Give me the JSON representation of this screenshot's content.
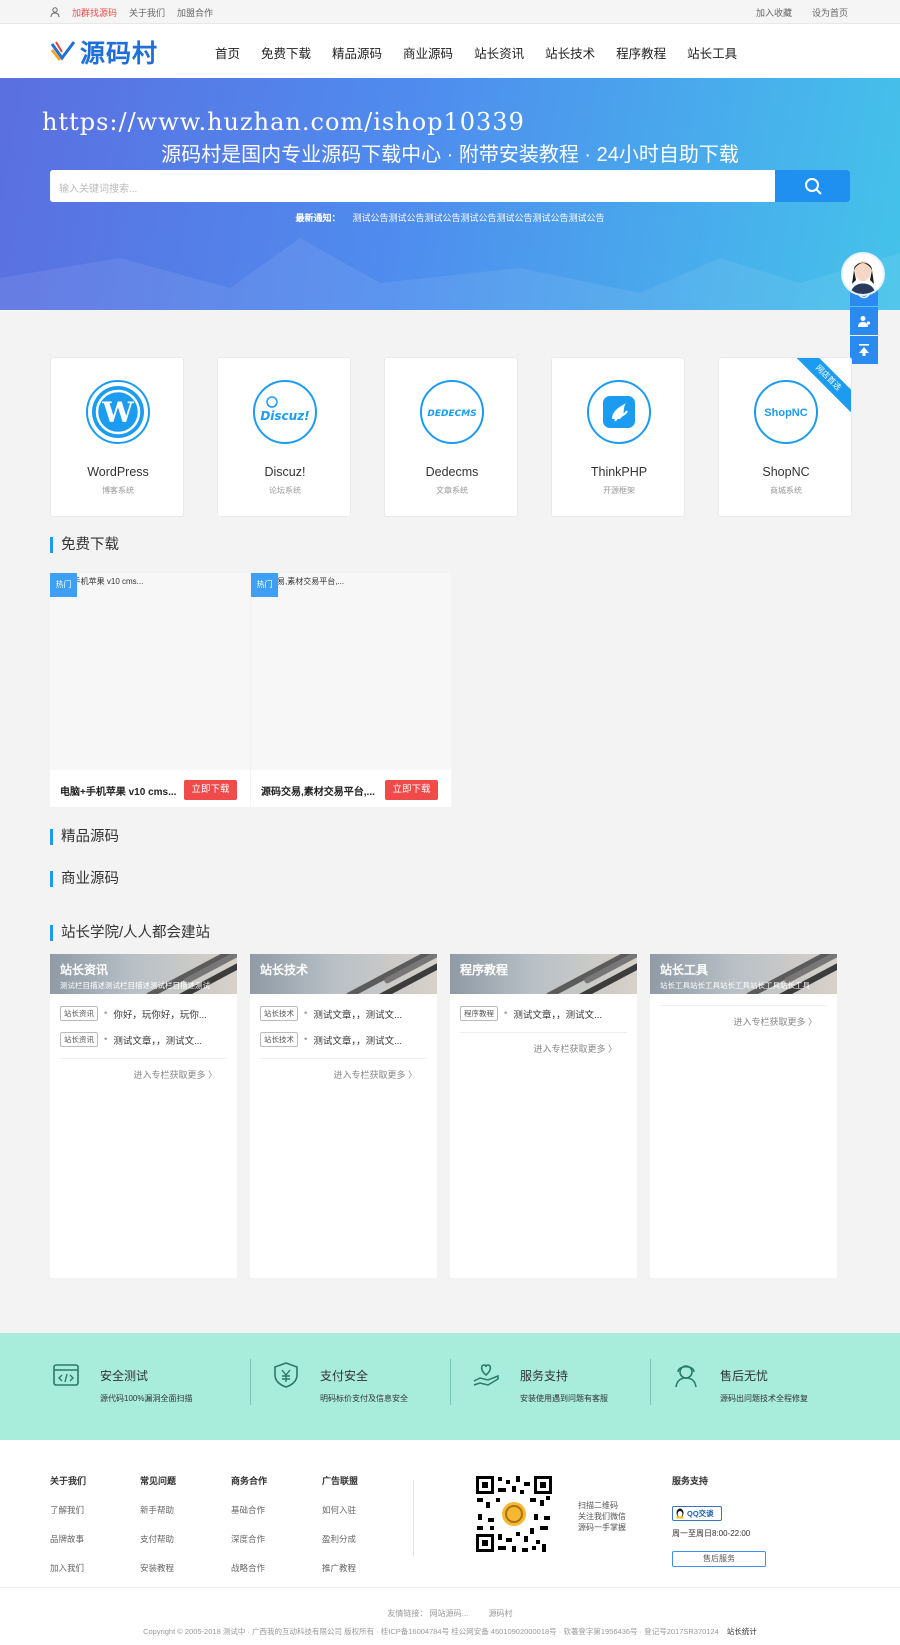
{
  "topbar": {
    "left": [
      "加群找源码",
      "关于我们",
      "加盟合作"
    ],
    "right": [
      "加入收藏",
      "设为首页"
    ]
  },
  "header": {
    "logo_text": "源码村",
    "nav": [
      "首页",
      "免费下载",
      "精品源码",
      "商业源码",
      "站长资讯",
      "站长技术",
      "程序教程",
      "站长工具"
    ]
  },
  "banner": {
    "watermark": "https://www.huzhan.com/ishop10339",
    "slogan": "源码村是国内专业源码下载中心 · 附带安装教程 · 24小时自助下载",
    "search_placeholder": "输入关键词搜索...",
    "notice_label": "最新通知：",
    "notice_text": "测试公告测试公告测试公告测试公告测试公告测试公告测试公告"
  },
  "cms": [
    {
      "name": "WordPress",
      "sub": "博客系统",
      "icon": "wordpress-icon"
    },
    {
      "name": "Discuz!",
      "sub": "论坛系统",
      "icon": "discuz-icon"
    },
    {
      "name": "Dedecms",
      "sub": "文章系统",
      "icon": "dedecms-icon"
    },
    {
      "name": "ThinkPHP",
      "sub": "开源框架",
      "icon": "thinkphp-icon"
    },
    {
      "name": "ShopNC",
      "sub": "商城系统",
      "icon": "shopnc-icon",
      "ribbon": "网店首选"
    }
  ],
  "sections": {
    "free": "免费下载",
    "premium": "精品源码",
    "business": "商业源码",
    "academy": "站长学院/人人都会建站"
  },
  "free_items": [
    {
      "tag": "热门",
      "alt": "电脑+手机苹果 v10 cms...",
      "title": "电脑+手机苹果 v10 cms...",
      "button": "立即下载"
    },
    {
      "tag": "热门",
      "alt": "源码交易,素材交易平台,...",
      "title": "源码交易,素材交易平台,...",
      "button": "立即下载"
    }
  ],
  "columns": [
    {
      "title": "站长资讯",
      "desc": "测试栏目描述测试栏目描述测试栏目描述测试",
      "items": [
        {
          "badge": "站长资讯",
          "text": "你好，玩你好，玩你..."
        },
        {
          "badge": "站长资讯",
          "text": "测试文章，，测试文..."
        }
      ],
      "more": "进入专栏获取更多 〉"
    },
    {
      "title": "站长技术",
      "desc": "",
      "items": [
        {
          "badge": "站长技术",
          "text": "测试文章，，测试文..."
        },
        {
          "badge": "站长技术",
          "text": "测试文章，，测试文..."
        }
      ],
      "more": "进入专栏获取更多 〉"
    },
    {
      "title": "程序教程",
      "desc": "",
      "items": [
        {
          "badge": "程序教程",
          "text": "测试文章，，测试文..."
        }
      ],
      "more": "进入专栏获取更多 〉"
    },
    {
      "title": "站长工具",
      "desc": "站长工具站长工具站长工具站长工具站长工具",
      "items": [],
      "more": "进入专栏获取更多 〉"
    }
  ],
  "features": [
    {
      "title": "安全测试",
      "desc": "源代码100%漏洞全面扫描"
    },
    {
      "title": "支付安全",
      "desc": "明码标价支付及信息安全"
    },
    {
      "title": "服务支持",
      "desc": "安装使用遇到问题有客服"
    },
    {
      "title": "售后无忧",
      "desc": "源码出问题技术全程修复"
    }
  ],
  "footer": {
    "cols": [
      {
        "h": "关于我们",
        "items": [
          "了解我们",
          "品牌故事",
          "加入我们"
        ]
      },
      {
        "h": "常见问题",
        "items": [
          "新手帮助",
          "支付帮助",
          "安装教程"
        ]
      },
      {
        "h": "商务合作",
        "items": [
          "基础合作",
          "深度合作",
          "战略合作"
        ]
      },
      {
        "h": "广告联盟",
        "items": [
          "如何入驻",
          "盈利分成",
          "推广教程"
        ]
      }
    ],
    "qr_text": [
      "扫描二维码",
      "关注我们微信",
      "源码一手掌握"
    ],
    "service_title": "服务支持",
    "qq_label": "QQ交谈",
    "hours": "周一至周日8:00-22:00",
    "after_sale": "售后服务",
    "links_label": "友情链接：",
    "links": [
      "网站源码...",
      "源码村"
    ],
    "copyright": "Copyright © 2005-2018 测试中 · 广西我的互动科技有限公司 版权所有 · 桂ICP备16004784号 桂公网安备 45010902000018号 · 软著登字第1956436号 · 登记号2017SR370124",
    "stats": "站长统计"
  }
}
